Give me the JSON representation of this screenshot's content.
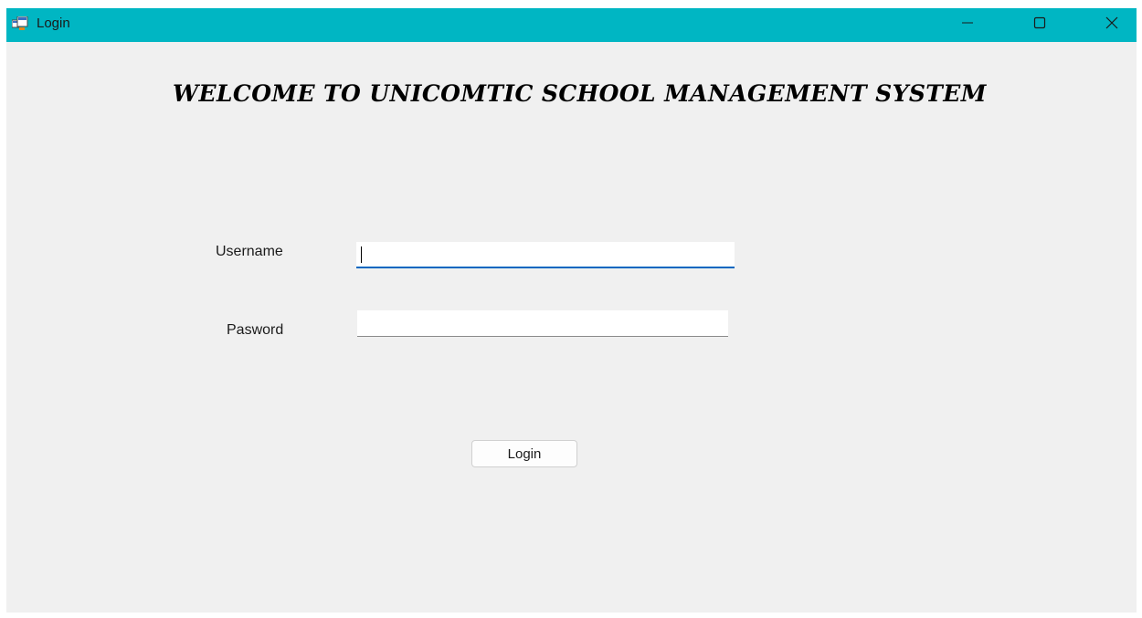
{
  "window": {
    "title": "Login",
    "icons": {
      "app": "app-window-icon",
      "minimize": "minimize-icon",
      "maximize": "maximize-icon",
      "close": "close-icon"
    },
    "titlebar_color": "#00b6c3"
  },
  "form": {
    "welcome": "WELCOME TO UNICOMTIC SCHOOL MANAGEMENT SYSTEM",
    "username_label": "Username",
    "username_value": "",
    "password_label": "Pasword",
    "password_value": "",
    "login_button": "Login",
    "focus_color": "#0067c0"
  }
}
